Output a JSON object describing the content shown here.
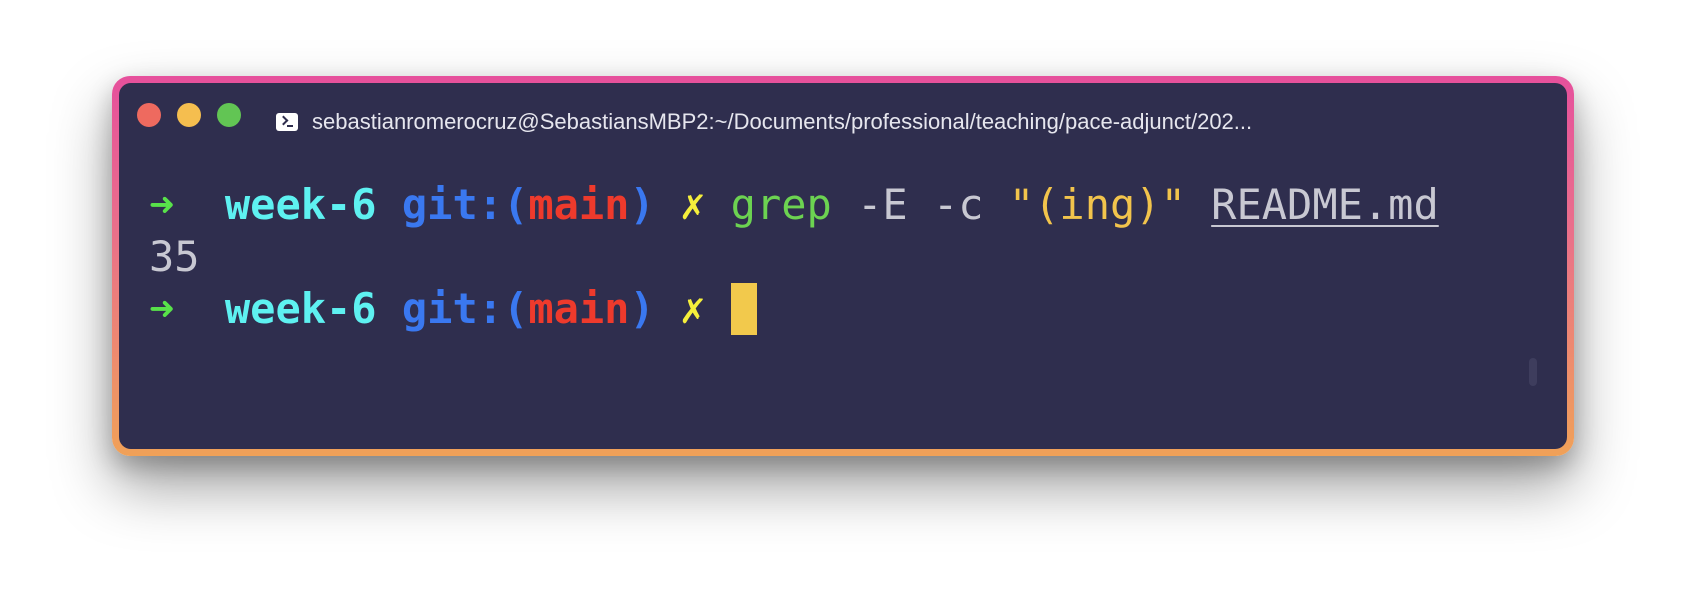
{
  "window": {
    "title": "sebastianromerocruz@SebastiansMBP2:~/Documents/professional/teaching/pace-adjunct/202...",
    "title_icon": "terminal-icon",
    "buttons": [
      "close",
      "minimize",
      "zoom"
    ],
    "colors": {
      "background": "#2f2e4e",
      "border_top": "#e6509c",
      "border_bottom": "#f0a158"
    }
  },
  "terminal": {
    "line1": {
      "arrow": "➜",
      "dir": "week-6",
      "git_label": "git:(",
      "branch": "main",
      "git_close": ")",
      "dirty": "✗",
      "command": "grep",
      "flags": "-E -c",
      "pattern": "\"(ing)\"",
      "file": "README.md"
    },
    "output": "35",
    "line2": {
      "arrow": "➜",
      "dir": "week-6",
      "git_label": "git:(",
      "branch": "main",
      "git_close": ")",
      "dirty": "✗"
    },
    "colors": {
      "arrow": "#58e24a",
      "dir": "#5ef1f1",
      "git": "#3a78f0",
      "branch": "#ee3a2c",
      "dirty": "#f5ef3b",
      "command": "#6cd351",
      "string": "#f2c44c",
      "cursor": "#f2c94c"
    }
  }
}
